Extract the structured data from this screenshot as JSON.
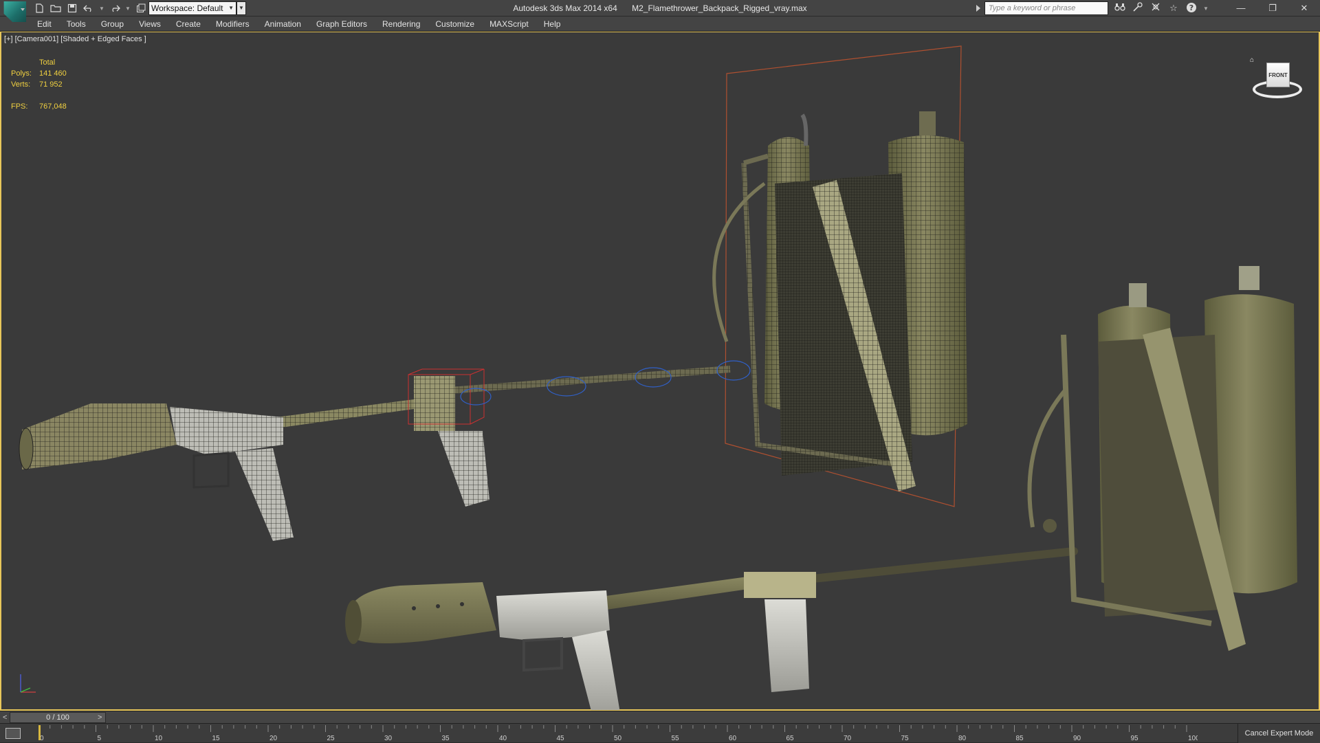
{
  "titlebar": {
    "app_name": "Autodesk 3ds Max  2014 x64",
    "file_name": "M2_Flamethrower_Backpack_Rigged_vray.max",
    "workspace_label": "Workspace: Default",
    "search_placeholder": "Type a keyword or phrase"
  },
  "menu": [
    "Edit",
    "Tools",
    "Group",
    "Views",
    "Create",
    "Modifiers",
    "Animation",
    "Graph Editors",
    "Rendering",
    "Customize",
    "MAXScript",
    "Help"
  ],
  "viewport": {
    "label": "[+] [Camera001] [Shaded + Edged Faces ]",
    "stats_header": "Total",
    "polys_label": "Polys:",
    "polys_value": "141 460",
    "verts_label": "Verts:",
    "verts_value": "71 952",
    "fps_label": "FPS:",
    "fps_value": "767,048",
    "viewcube_face": "FRONT"
  },
  "timeslider": {
    "frame_display": "0 / 100",
    "prev": "<",
    "next": ">"
  },
  "trackbar": {
    "ticks": [
      0,
      5,
      10,
      15,
      20,
      25,
      30,
      35,
      40,
      45,
      50,
      55,
      60,
      65,
      70,
      75,
      80,
      85,
      90,
      95,
      100
    ],
    "current_frame": 0,
    "cancel_expert_label": "Cancel Expert Mode"
  },
  "colors": {
    "viewport_border": "#e8c75a",
    "stats_text": "#f0d040",
    "model_olive": "#7c7a55",
    "metal_grey": "#c9c9c4"
  }
}
